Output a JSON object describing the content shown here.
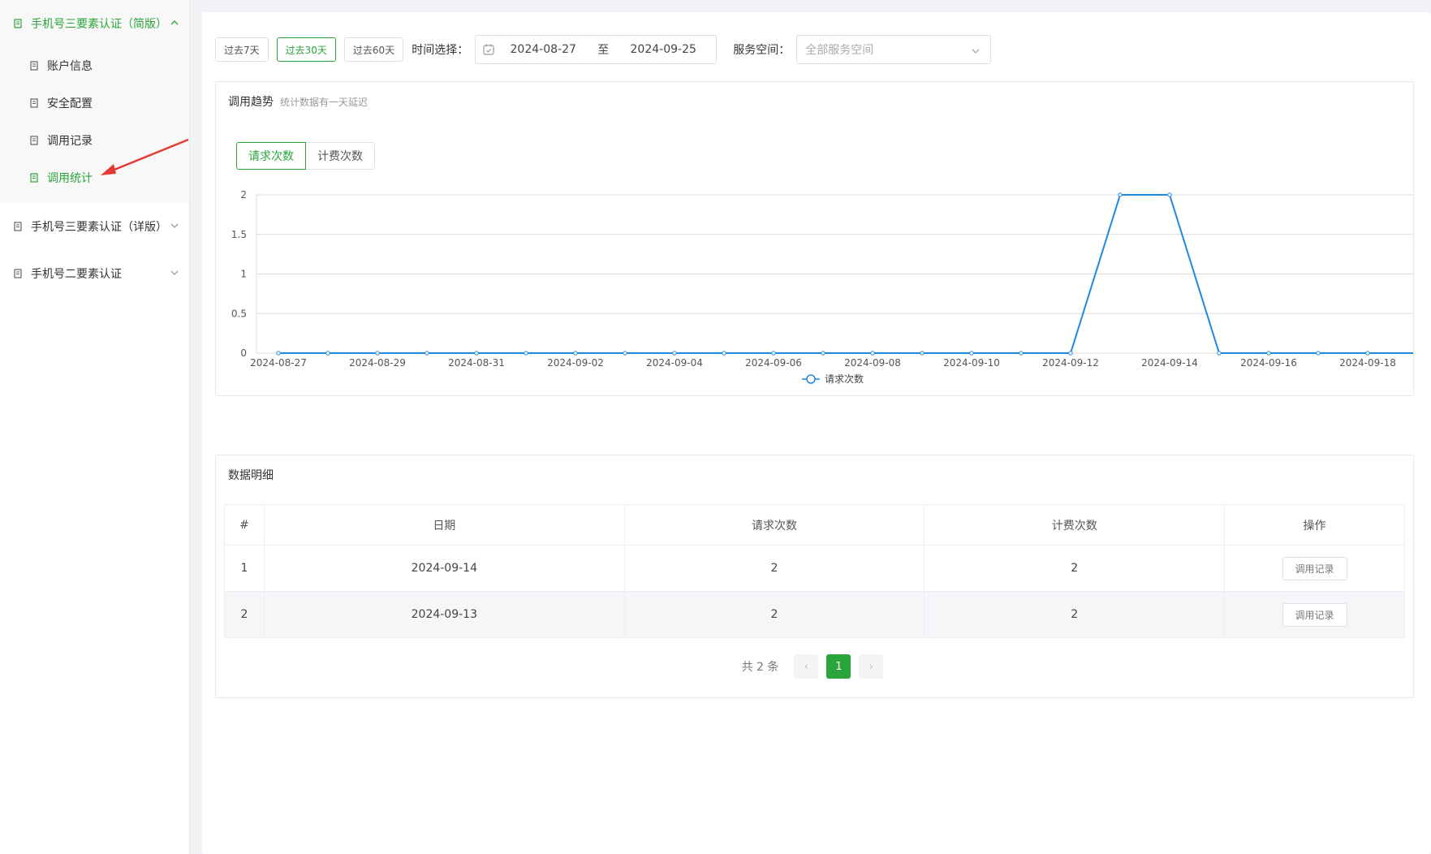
{
  "sidebar": {
    "groups": [
      {
        "label": "手机号三要素认证（简版）",
        "expanded": true,
        "items": [
          {
            "label": "账户信息"
          },
          {
            "label": "安全配置"
          },
          {
            "label": "调用记录"
          },
          {
            "label": "调用统计",
            "active": true
          }
        ]
      },
      {
        "label": "手机号三要素认证（详版）",
        "expanded": false
      },
      {
        "label": "手机号二要素认证",
        "expanded": false
      }
    ]
  },
  "toolbar": {
    "range_buttons": [
      "过去7天",
      "过去30天",
      "过去60天"
    ],
    "active_range": "过去30天",
    "time_label": "时间选择：",
    "date_start": "2024-08-27",
    "date_sep": "至",
    "date_end": "2024-09-25",
    "space_label": "服务空间：",
    "space_placeholder": "全部服务空间"
  },
  "trend": {
    "title": "调用趋势",
    "subtitle": "统计数据有一天延迟",
    "tabs": [
      "请求次数",
      "计费次数"
    ],
    "active_tab": "请求次数"
  },
  "chart_data": {
    "type": "line",
    "x": [
      "2024-08-27",
      "2024-08-28",
      "2024-08-29",
      "2024-08-30",
      "2024-08-31",
      "2024-09-01",
      "2024-09-02",
      "2024-09-03",
      "2024-09-04",
      "2024-09-05",
      "2024-09-06",
      "2024-09-07",
      "2024-09-08",
      "2024-09-09",
      "2024-09-10",
      "2024-09-11",
      "2024-09-12",
      "2024-09-13",
      "2024-09-14",
      "2024-09-15",
      "2024-09-16",
      "2024-09-17",
      "2024-09-18",
      "2024-09-19"
    ],
    "x_tick_labels": [
      "2024-08-27",
      "2024-08-29",
      "2024-08-31",
      "2024-09-02",
      "2024-09-04",
      "2024-09-06",
      "2024-09-08",
      "2024-09-10",
      "2024-09-12",
      "2024-09-14",
      "2024-09-16",
      "2024-09-18"
    ],
    "series": [
      {
        "name": "请求次数",
        "values": [
          0,
          0,
          0,
          0,
          0,
          0,
          0,
          0,
          0,
          0,
          0,
          0,
          0,
          0,
          0,
          0,
          0,
          2,
          2,
          0,
          0,
          0,
          0,
          0
        ]
      }
    ],
    "ylim": [
      0,
      2
    ],
    "y_ticks": [
      "0",
      "0.5",
      "1",
      "1.5",
      "2"
    ],
    "grid": true,
    "legend": "bottom-center",
    "color": "#1e88e5"
  },
  "detail": {
    "title": "数据明细",
    "columns": [
      "#",
      "日期",
      "请求次数",
      "计费次数",
      "操作"
    ],
    "rows": [
      {
        "idx": "1",
        "date": "2024-09-14",
        "requests": "2",
        "billed": "2",
        "action": "调用记录"
      },
      {
        "idx": "2",
        "date": "2024-09-13",
        "requests": "2",
        "billed": "2",
        "action": "调用记录"
      }
    ],
    "pager": {
      "total": "共 2 条",
      "current": "1",
      "prev": "‹",
      "next": "›"
    }
  },
  "colors": {
    "accent": "#2aa53b",
    "line": "#1e88e5",
    "annotation_arrow": "#e53935"
  }
}
